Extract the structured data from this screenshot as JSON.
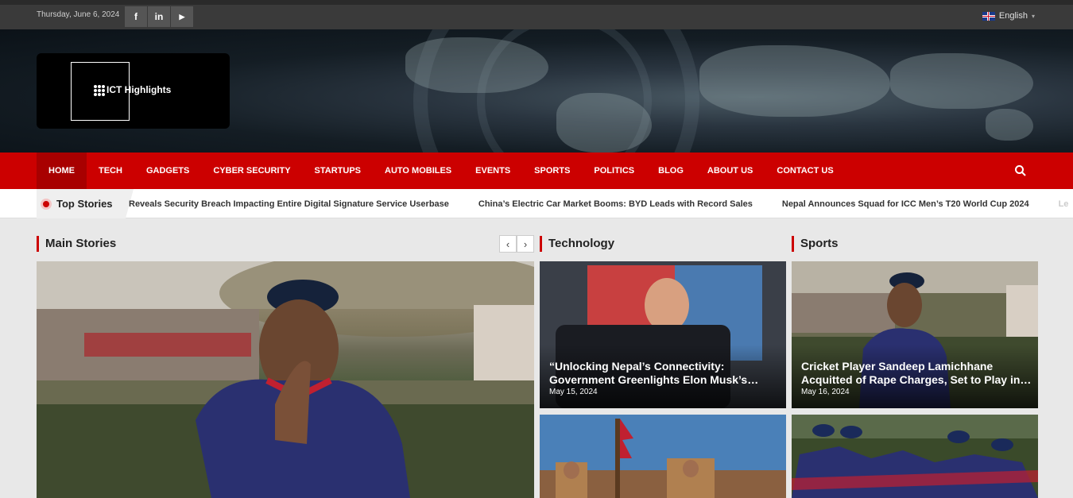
{
  "topbar": {
    "date": "Thursday, June 6, 2024",
    "social": [
      {
        "icon": "facebook-icon",
        "glyph": "f"
      },
      {
        "icon": "linkedin-icon",
        "glyph": "in"
      },
      {
        "icon": "youtube-icon",
        "glyph": "▶"
      }
    ],
    "language": "English"
  },
  "header": {
    "logo_text": "ICT Highlights"
  },
  "nav": {
    "items": [
      "HOME",
      "TECH",
      "GADGETS",
      "CYBER SECURITY",
      "STARTUPS",
      "AUTO MOBILES",
      "EVENTS",
      "SPORTS",
      "POLITICS",
      "BLOG",
      "ABOUT US",
      "CONTACT US"
    ],
    "active": "HOME",
    "accent": "#cc0000"
  },
  "ticker": {
    "label": "Top Stories",
    "items": [
      "Reveals Security Breach Impacting Entire Digital Signature Service Userbase",
      "China’s Electric Car Market Booms: BYD Leads with Record Sales",
      "Nepal Announces Squad for ICC Men’s T20 World Cup 2024",
      "Le"
    ]
  },
  "sections": {
    "main": "Main Stories",
    "technology": "Technology",
    "sports": "Sports"
  },
  "tech_cards": [
    {
      "title": "“Unlocking Nepal’s Connectivity: Government Greenlights Elon Musk’s…",
      "date": "May 15, 2024"
    }
  ],
  "sports_cards": [
    {
      "title": "Cricket Player Sandeep Lamichhane Acquitted of Rape Charges, Set to Play in…",
      "date": "May 16, 2024"
    }
  ],
  "slider_controls": {
    "prev": "‹",
    "next": "›"
  }
}
